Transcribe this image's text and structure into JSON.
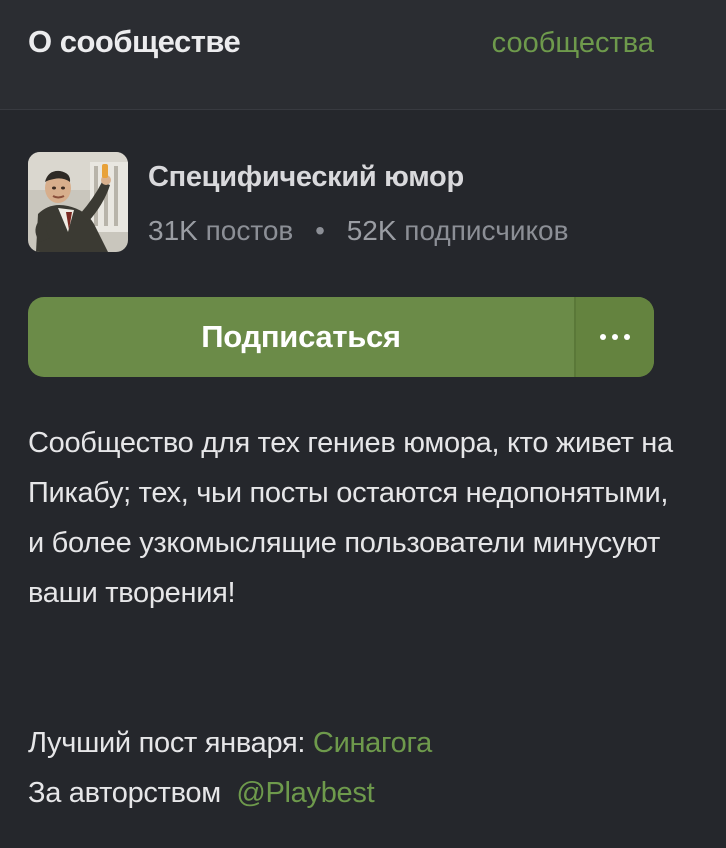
{
  "header": {
    "title": "О сообществе",
    "link_label": "сообщества"
  },
  "community": {
    "name": "Специфический юмор",
    "posts_count": "31K",
    "posts_label": "постов",
    "separator": "•",
    "subscribers_count": "52K",
    "subscribers_label": "подписчиков",
    "avatar_icon": "community-avatar-image"
  },
  "actions": {
    "subscribe_label": "Подписаться",
    "more_icon": "more-dots-icon"
  },
  "description": {
    "text": "Сообщество для тех гениев юмора, кто живет на Пикабу; тех, чьи посты остаются недопонятыми, и более узкомыслящие пользователи минусуют ваши творения!"
  },
  "best_post": {
    "label": "Лучший пост января:",
    "post_title": "Синагога",
    "author_label": "За авторством",
    "author_handle": "@Playbest"
  },
  "colors": {
    "background": "#25272c",
    "header_background": "#2b2d32",
    "accent_green": "#6e9a4c",
    "button_green": "#6b8b48"
  }
}
